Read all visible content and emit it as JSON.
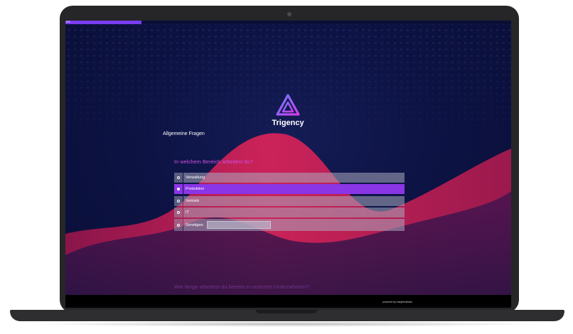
{
  "progress": {
    "label": "0%",
    "fraction": 0.17
  },
  "brand": {
    "name": "Trigency"
  },
  "survey": {
    "section_title": "Allgemeine Fragen",
    "question": "In welchem Bereich arbeitest du?",
    "options": [
      {
        "label": "Verwaltung",
        "selected": false
      },
      {
        "label": "Produktion",
        "selected": true
      },
      {
        "label": "Vertrieb",
        "selected": false
      },
      {
        "label": "IT",
        "selected": false
      }
    ],
    "other": {
      "label": "Sonstiges:",
      "value": ""
    },
    "next_question": "Wie lange arbeitest du bereits in unserem Unternehmen?"
  },
  "footer": {
    "powered_by": "powered by easyfeedback"
  },
  "colors": {
    "accent": "#8a35e6",
    "question": "#d34ee0",
    "background": "#0d1344",
    "wave": "#e0245a"
  },
  "icons": {
    "logo": "triangle-logo-icon",
    "radio": "radio-icon"
  }
}
